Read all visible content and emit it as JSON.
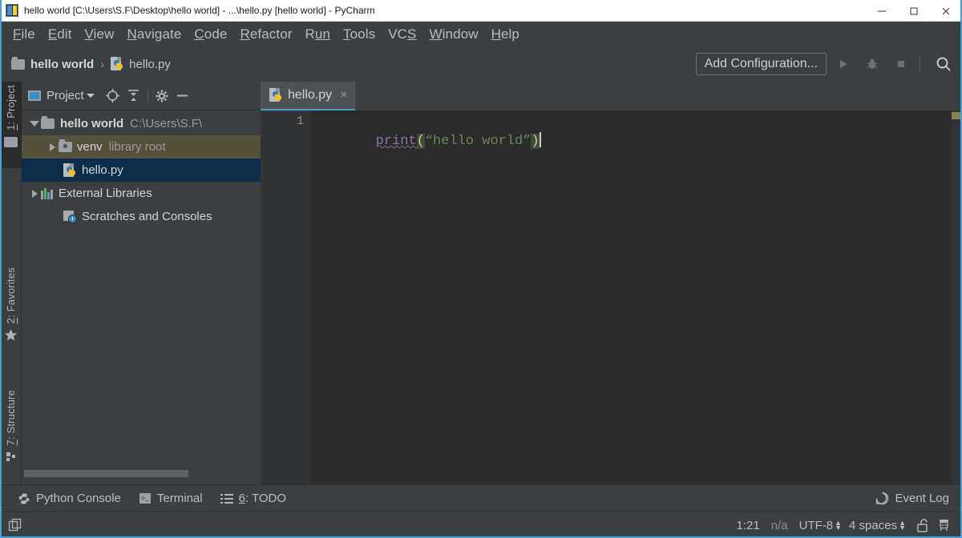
{
  "window": {
    "title": "hello world [C:\\Users\\S.F\\Desktop\\hello world] - ...\\hello.py [hello world] - PyCharm",
    "app_icon": "pycharm-icon",
    "controls": {
      "minimize": "minimize-icon",
      "maximize": "maximize-icon",
      "close": "close-icon"
    }
  },
  "menubar": {
    "items": [
      {
        "label": "File",
        "pre": "F",
        "rest": "ile"
      },
      {
        "label": "Edit",
        "pre": "E",
        "rest": "dit"
      },
      {
        "label": "View",
        "pre": "V",
        "rest": "iew"
      },
      {
        "label": "Navigate",
        "pre": "N",
        "rest": "avigate"
      },
      {
        "label": "Code",
        "pre": "C",
        "rest": "ode"
      },
      {
        "label": "Refactor",
        "pre": "R",
        "rest": "efactor"
      },
      {
        "label": "Run",
        "pre": "R",
        "rest": "un"
      },
      {
        "label": "Tools",
        "pre": "T",
        "rest": "ools"
      },
      {
        "label": "VCS",
        "pre": "VC",
        "rest": "S"
      },
      {
        "label": "Window",
        "pre": "W",
        "rest": "indow"
      },
      {
        "label": "Help",
        "pre": "H",
        "rest": "elp"
      }
    ]
  },
  "navbar": {
    "breadcrumb": [
      {
        "label": "hello world",
        "icon": "folder-icon"
      },
      {
        "label": "hello.py",
        "icon": "python-file-icon"
      }
    ],
    "separator": "›",
    "run_config_label": "Add Configuration...",
    "buttons": [
      {
        "name": "run-button",
        "icon": "play-icon",
        "enabled": false
      },
      {
        "name": "debug-button",
        "icon": "bug-icon",
        "enabled": false
      },
      {
        "name": "stop-button",
        "icon": "stop-square-icon",
        "enabled": false
      },
      {
        "name": "search-everywhere-button",
        "icon": "search-icon",
        "enabled": true
      }
    ]
  },
  "left_strip": {
    "buttons": [
      {
        "label": "1: Project",
        "pre": "1",
        "rest": ": Project",
        "icon": "folder-icon",
        "active": true
      },
      {
        "label": "2: Favorites",
        "pre": "2",
        "rest": ": Favorites",
        "icon": "star-icon",
        "active": false
      },
      {
        "label": "7: Structure",
        "pre": "7",
        "rest": ": Structure",
        "icon": "structure-icon",
        "active": false
      }
    ]
  },
  "project_panel": {
    "title": "Project",
    "header_icons": [
      {
        "name": "select-opened-file-icon",
        "glyph": "target-icon"
      },
      {
        "name": "collapse-all-icon",
        "glyph": "collapse-icon"
      },
      {
        "name": "settings-icon",
        "glyph": "gear-icon"
      },
      {
        "name": "hide-panel-icon",
        "glyph": "minus-icon"
      }
    ],
    "tree": [
      {
        "label": "hello world",
        "sub": "C:\\Users\\S.F\\",
        "icon": "folder-icon",
        "expanded": true,
        "bold": true,
        "indent": 1,
        "selected": "none"
      },
      {
        "label": "venv",
        "sub": "library root",
        "icon": "module-folder-icon",
        "expanded": false,
        "bold": false,
        "indent": 2,
        "selected": "olive"
      },
      {
        "label": "hello.py",
        "sub": "",
        "icon": "python-file-icon",
        "expanded": null,
        "bold": false,
        "indent": 3,
        "selected": "blue"
      },
      {
        "label": "External Libraries",
        "sub": "",
        "icon": "libraries-icon",
        "expanded": false,
        "bold": false,
        "indent": 1,
        "selected": "none"
      },
      {
        "label": "Scratches and Consoles",
        "sub": "",
        "icon": "scratches-icon",
        "expanded": null,
        "bold": false,
        "indent": 2,
        "selected": "none"
      }
    ]
  },
  "editor": {
    "tabs": [
      {
        "label": "hello.py",
        "icon": "python-file-icon",
        "active": true,
        "close": "×"
      }
    ],
    "line_numbers": [
      "1"
    ],
    "code_tokens": {
      "fn": "print",
      "open_paren": "(",
      "string": "“hello world”",
      "close_paren": ")"
    },
    "code_plain": "print(“hello world”)",
    "colors": {
      "background": "#2b2b2b",
      "gutter": "#313335",
      "function": "#9373a5",
      "string": "#6a8759",
      "paren": "#d8d84a",
      "tab_underline": "#46a0c8"
    },
    "analysis_marker_color": "#7d7557"
  },
  "bottom_bar": {
    "items": [
      {
        "label": "Python Console",
        "icon": "python-icon"
      },
      {
        "label": "Terminal",
        "icon": "terminal-icon"
      },
      {
        "label": "6: TODO",
        "pre": "6",
        "rest": ": TODO",
        "icon": "todo-list-icon"
      }
    ],
    "right": {
      "label": "Event Log",
      "icon": "event-log-icon"
    }
  },
  "status_bar": {
    "caret_position": "1:21",
    "vcs": "n/a",
    "encoding": "UTF-8",
    "indent": "4 spaces",
    "lock_icon": "unlocked-padlock-icon",
    "inspector_icon": "inspector-icon",
    "spinner_glyph": "↕",
    "left_icon": "open-windows-icon"
  }
}
